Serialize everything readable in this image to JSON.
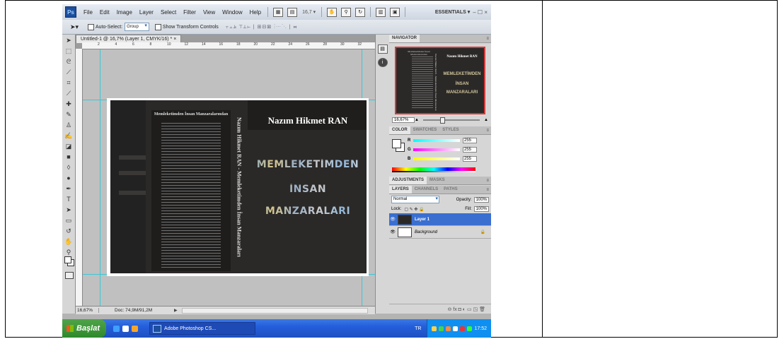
{
  "app": {
    "logo_text": "Ps",
    "menu": [
      "File",
      "Edit",
      "Image",
      "Layer",
      "Select",
      "Filter",
      "View",
      "Window",
      "Help"
    ],
    "zoom_dropdown": "16,7 ▾",
    "workspace_label": "ESSENTIALS ▾",
    "window_controls": "– ☐ ×"
  },
  "options_bar": {
    "auto_select_label": "Auto-Select:",
    "auto_select_value": "Group",
    "show_transform_label": "Show Transform Controls"
  },
  "document": {
    "tab_title": "Untitled-1 @ 16,7% (Layer 1, CMYK/16) * ×",
    "ruler_marks": [
      "2",
      "4",
      "6",
      "8",
      "10",
      "12",
      "14",
      "16",
      "18",
      "20",
      "22",
      "24",
      "26",
      "28",
      "30",
      "32"
    ],
    "status_zoom": "16,67%",
    "status_doc": "Doc: 74,9M/91,2M",
    "artwork": {
      "back_cover_title": "Memleketimden İnsan Manzaralarından",
      "spine_text": "Nazım Hikmet RAN - Memleketimden İnsan Manzaraları",
      "author": "Nazım Hikmet RAN",
      "title_line1": "MEMLEKETİMDEN",
      "title_line2": "İNSAN",
      "title_line3": "MANZARALARI"
    }
  },
  "panels": {
    "navigator": {
      "tabs": [
        "NAVIGATOR"
      ],
      "zoom_value": "16,67%"
    },
    "color": {
      "tabs": [
        "COLOR",
        "SWATCHES",
        "STYLES"
      ],
      "channels": [
        {
          "label": "R",
          "value": "255"
        },
        {
          "label": "G",
          "value": "255"
        },
        {
          "label": "B",
          "value": "255"
        }
      ]
    },
    "adjustments": {
      "tabs": [
        "ADJUSTMENTS",
        "MASKS"
      ]
    },
    "layers": {
      "tabs": [
        "LAYERS",
        "CHANNELS",
        "PATHS"
      ],
      "blend_mode": "Normal",
      "opacity_label": "Opacity:",
      "opacity_value": "100%",
      "lock_label": "Lock:",
      "fill_label": "Fill:",
      "fill_value": "100%",
      "items": [
        {
          "name": "Layer 1",
          "selected": true
        },
        {
          "name": "Background",
          "selected": false,
          "lock": "🔒"
        }
      ],
      "footer_icons": "⊖ fx ◘ ◐ ▭ ◳ 🗑"
    }
  },
  "taskbar": {
    "start_label": "Başlat",
    "task_label": "Adobe Photoshop CS...",
    "language": "TR",
    "clock": "17:52"
  },
  "colors": {
    "canvas_bg": "#2b2928",
    "guide": "#37c9d8",
    "selected_layer": "#3a6fd0",
    "taskbar": "#245edb"
  }
}
